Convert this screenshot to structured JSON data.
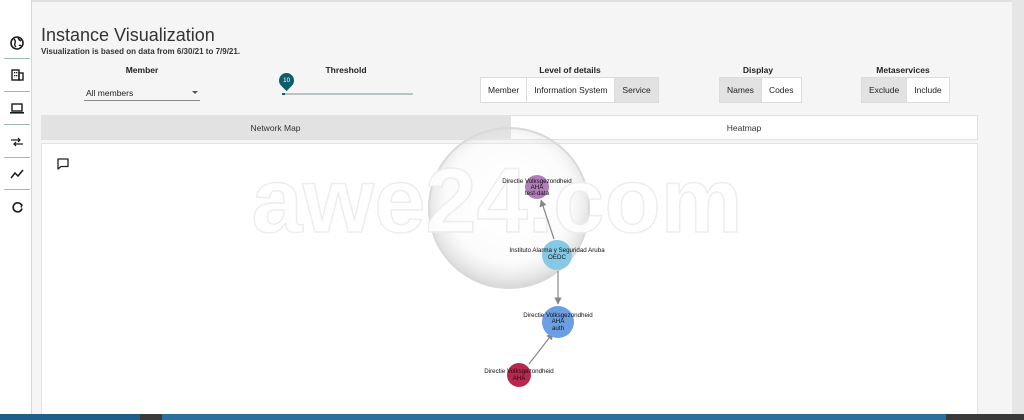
{
  "page": {
    "title": "Instance Visualization",
    "subtitle": "Visualization is based on data from 6/30/21 to 7/9/21."
  },
  "sidebar": {
    "items": [
      {
        "icon": "globe-icon"
      },
      {
        "icon": "building-icon"
      },
      {
        "icon": "laptop-icon"
      },
      {
        "icon": "transfer-icon"
      },
      {
        "icon": "trend-line-icon"
      },
      {
        "icon": "refresh-icon"
      }
    ]
  },
  "controls": {
    "member": {
      "label": "Member",
      "value": "All members"
    },
    "threshold": {
      "label": "Threshold",
      "value": "10",
      "fraction": 0.02
    },
    "level_of_details": {
      "label": "Level of details",
      "options": [
        "Member",
        "Information System",
        "Service"
      ],
      "selected": "Service"
    },
    "display": {
      "label": "Display",
      "options": [
        "Names",
        "Codes"
      ],
      "selected": "Names"
    },
    "metaservices": {
      "label": "Metaservices",
      "options": [
        "Exclude",
        "Include"
      ],
      "selected": "Exclude"
    }
  },
  "tabs": [
    {
      "label": "Network Map",
      "active": true
    },
    {
      "label": "Heatmap",
      "active": false
    }
  ],
  "watermark": {
    "text": "awe24.com"
  },
  "graph": {
    "nodes": [
      {
        "id": "n1",
        "lines": [
          "Directie Volksgezondheid",
          "AHA",
          "test-data"
        ],
        "color": "#b07fb8"
      },
      {
        "id": "n2",
        "lines": [
          "Instituto Alarma y Seguridad Aruba",
          "OEDC"
        ],
        "color": "#86c9e4"
      },
      {
        "id": "n3",
        "lines": [
          "Directie Volksgezondheid",
          "AHA",
          "auth"
        ],
        "color": "#6b9fe4"
      },
      {
        "id": "n4",
        "lines": [
          "Directie Volksgezondheid",
          "AHA"
        ],
        "color": "#b8284d"
      }
    ],
    "edges": [
      {
        "from": "n4",
        "to": "n3"
      },
      {
        "from": "n2",
        "to": "n3"
      },
      {
        "from": "n2",
        "to": "n1"
      }
    ]
  }
}
